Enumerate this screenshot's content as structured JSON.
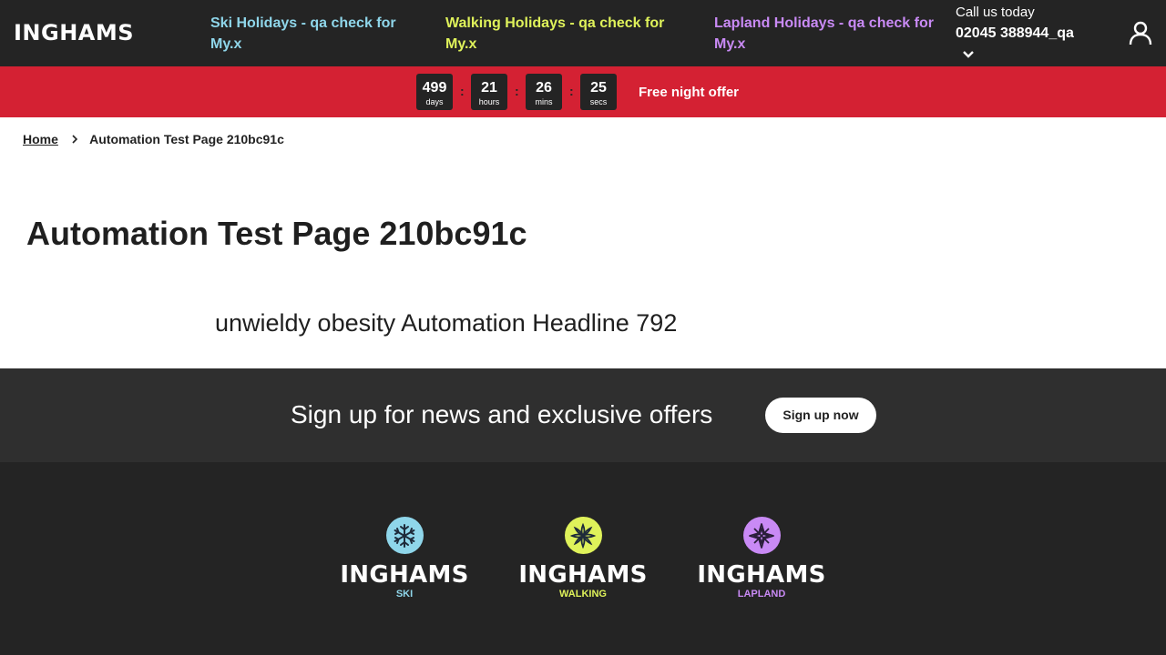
{
  "header": {
    "logo": "INGHAMS",
    "nav": [
      {
        "label": "Ski Holidays - qa check for My.x",
        "color": "#8fd6ea"
      },
      {
        "label": "Walking Holidays - qa check for My.x",
        "color": "#dff25a"
      },
      {
        "label": "Lapland Holidays - qa check for My.x",
        "color": "#c98af5"
      }
    ],
    "call_label": "Call us today",
    "call_number": "02045 388944_qa",
    "chevron_icon": "chevron-down-icon",
    "account_icon": "user-icon"
  },
  "offer": {
    "countdown": [
      {
        "value": "499",
        "unit": "days"
      },
      {
        "value": "21",
        "unit": "hours"
      },
      {
        "value": "26",
        "unit": "mins"
      },
      {
        "value": "25",
        "unit": "secs"
      }
    ],
    "separator": ":",
    "text": "Free night offer",
    "color": "#d42133"
  },
  "breadcrumb": {
    "home": "Home",
    "current": "Automation Test Page 210bc91c"
  },
  "page": {
    "title": "Automation Test Page 210bc91c",
    "headline": "unwieldy obesity Automation Headline 792"
  },
  "signup": {
    "text": "Sign up for news and exclusive offers",
    "button": "Sign up now"
  },
  "footer": {
    "brands": [
      {
        "name": "INGHAMS",
        "sub": "SKI",
        "color": "#8fd6ea",
        "icon": "snowflake-icon"
      },
      {
        "name": "INGHAMS",
        "sub": "WALKING",
        "color": "#dff25a",
        "icon": "flower-icon"
      },
      {
        "name": "INGHAMS",
        "sub": "LAPLAND",
        "color": "#c98af5",
        "icon": "star-icon"
      }
    ]
  }
}
